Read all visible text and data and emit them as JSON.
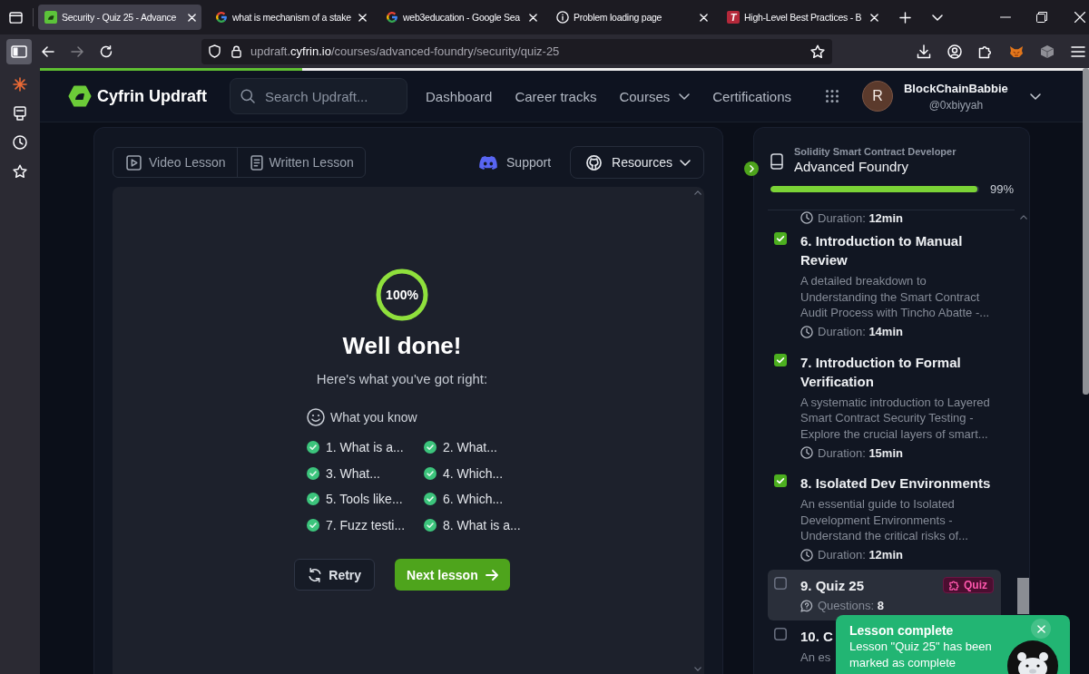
{
  "browser": {
    "tabs": [
      {
        "title": "Security - Quiz 25 - Advance",
        "kind": "cyfrin",
        "selected": true
      },
      {
        "title": "what is mechanism of a stake",
        "kind": "google",
        "selected": false
      },
      {
        "title": "web3education - Google Sea",
        "kind": "google",
        "selected": false
      },
      {
        "title": "Problem loading page",
        "kind": "info",
        "selected": false
      },
      {
        "title": "High-Level Best Practices - B",
        "kind": "letter",
        "favicon_text": "T",
        "selected": false
      }
    ],
    "navigation": {
      "back_disabled": false,
      "forward_disabled": true
    },
    "sidebar_open": true,
    "url": {
      "subdomain": "updraft.",
      "domain": "cyfrin.io",
      "path": "/courses/advanced-foundry/security/quiz-25"
    }
  },
  "header": {
    "page_progress": {
      "level": 0.25
    },
    "brand": "Cyfrin Updraft",
    "search": {
      "placeholder": "Search Updraft..."
    },
    "nav": [
      {
        "label": "Dashboard",
        "kind": "link"
      },
      {
        "label": "Career tracks",
        "kind": "link"
      },
      {
        "label": "Courses",
        "kind": "menu"
      },
      {
        "label": "Certifications",
        "kind": "link"
      }
    ],
    "user": {
      "avatar_letter": "R",
      "name": "BlockChainBabbie",
      "handle": "@0xbiyyah"
    }
  },
  "lesson": {
    "modes": [
      {
        "label": "Video Lesson",
        "kind": "video",
        "selected": false
      },
      {
        "label": "Written Lesson",
        "kind": "written",
        "selected": false
      }
    ],
    "support": "Support",
    "resources": "Resources",
    "result": {
      "score": "100%",
      "level": 1,
      "title": "Well done!",
      "subtitle": "Here's what you've got right:",
      "section": "What you know",
      "answers": [
        {
          "text": "1. What is a...",
          "correct": true
        },
        {
          "text": "2. What...",
          "correct": true
        },
        {
          "text": "3. What...",
          "correct": true
        },
        {
          "text": "4. Which...",
          "correct": true
        },
        {
          "text": "5. Tools like...",
          "correct": true
        },
        {
          "text": "6. Which...",
          "correct": true
        },
        {
          "text": "7. Fuzz testi...",
          "correct": true
        },
        {
          "text": "8. What is a...",
          "correct": true
        }
      ],
      "buttons": [
        {
          "label": "Retry",
          "kind": "retry"
        },
        {
          "label": "Next lesson",
          "kind": "next"
        }
      ]
    }
  },
  "course": {
    "track": "Solidity Smart Contract Developer",
    "title": "Advanced Foundry",
    "progress": {
      "level": 0.99,
      "reading": "99%"
    },
    "list_top_fragment": {
      "meta": "Duration: **12min**"
    },
    "lessons": [
      {
        "kind": "lesson",
        "title": "6. Introduction to Manual Review",
        "completed": true,
        "selected": false,
        "description": "A detailed breakdown to\nUnderstanding the Smart Contract\nAudit Process with Tincho Abatte -...",
        "meta": "Duration: **14min**"
      },
      {
        "kind": "lesson",
        "title": "7. Introduction to Formal Verification",
        "completed": true,
        "selected": false,
        "description": "A systematic introduction to Layered\nSmart Contract Security Testing -\nExplore the crucial layers of smart...",
        "meta": "Duration: **15min**"
      },
      {
        "kind": "lesson",
        "title": "8. Isolated Dev Environments",
        "completed": true,
        "selected": false,
        "description": "An essential guide to Isolated\nDevelopment Environments -\nUnderstand the critical risks of...",
        "meta": "Duration: **12min**"
      },
      {
        "kind": "quiz",
        "title": "9. Quiz 25",
        "completed": false,
        "selected": true,
        "badge": "Quiz",
        "meta": "Questions: **8**"
      },
      {
        "kind": "lesson",
        "title": "10. C",
        "completed": false,
        "selected": false,
        "description": "An es"
      }
    ]
  },
  "toast": {
    "title": "Lesson complete",
    "message": "Lesson \"Quiz 25\" has been\nmarked as complete"
  }
}
